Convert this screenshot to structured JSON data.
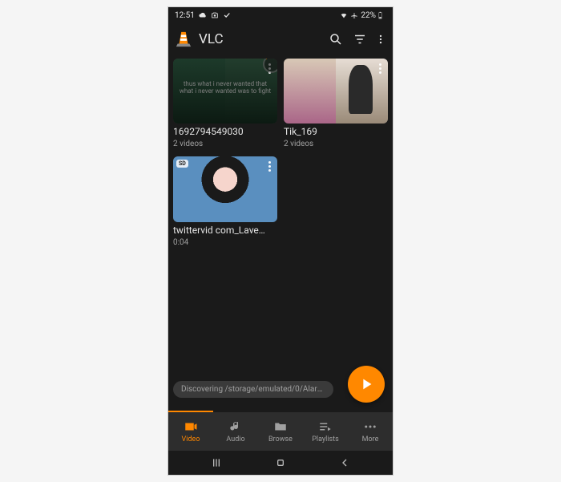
{
  "status": {
    "time": "12:51",
    "battery_pct": "22%"
  },
  "appbar": {
    "title": "VLC"
  },
  "folders": [
    {
      "title": "1692794549030",
      "subtitle": "2 videos",
      "kind": "folder",
      "loading": true,
      "caption": "thus what i never wanted that what i never wanted was to fight"
    },
    {
      "title": "Tik_169",
      "subtitle": "2 videos",
      "kind": "folder"
    }
  ],
  "videos": [
    {
      "title": "twittervid com_Lave…",
      "subtitle": "0:04",
      "kind": "video",
      "sd": true,
      "sd_label": "SD"
    }
  ],
  "discover": "Discovering /storage/emulated/0/Alarms/",
  "tabs": [
    {
      "label": "Video",
      "icon": "video",
      "active": true
    },
    {
      "label": "Audio",
      "icon": "audio"
    },
    {
      "label": "Browse",
      "icon": "browse"
    },
    {
      "label": "Playlists",
      "icon": "playlists"
    },
    {
      "label": "More",
      "icon": "more"
    }
  ]
}
